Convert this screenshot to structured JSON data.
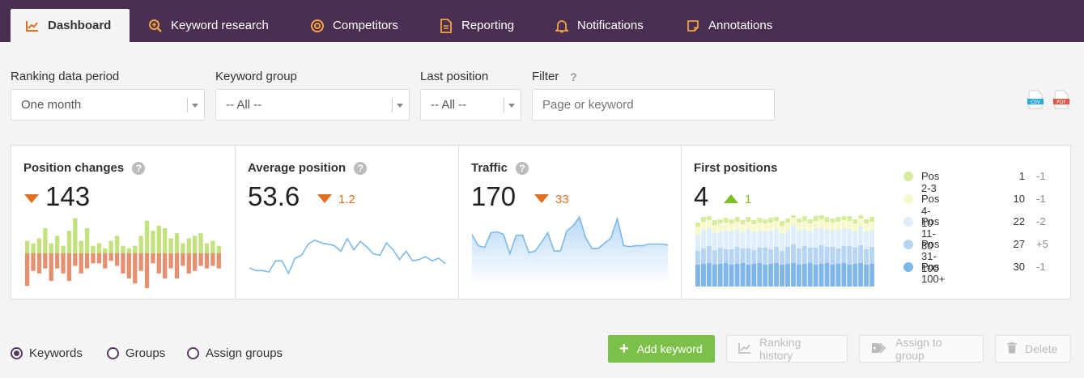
{
  "nav": {
    "tabs": [
      {
        "label": "Dashboard",
        "icon": "chart-line-icon"
      },
      {
        "label": "Keyword research",
        "icon": "magnifier-plus-icon"
      },
      {
        "label": "Competitors",
        "icon": "target-icon"
      },
      {
        "label": "Reporting",
        "icon": "document-icon"
      },
      {
        "label": "Notifications",
        "icon": "bell-icon"
      },
      {
        "label": "Annotations",
        "icon": "note-icon"
      }
    ],
    "active": "Dashboard"
  },
  "filters": {
    "period_label": "Ranking data period",
    "period_value": "One month",
    "group_label": "Keyword group",
    "group_value": "-- All --",
    "position_label": "Last position",
    "position_value": "-- All --",
    "filter_label": "Filter",
    "filter_help": "?",
    "filter_placeholder": "Page or keyword"
  },
  "export": {
    "csv_label": "CSV",
    "pdf_label": "PDF"
  },
  "stats": {
    "position_changes": {
      "title": "Position changes",
      "help": "?",
      "value": "143",
      "up": [
        5,
        4,
        6,
        10,
        4,
        7,
        3,
        9,
        14,
        5,
        10,
        3,
        4,
        2,
        5,
        7,
        3,
        2,
        3,
        7,
        13,
        9,
        11,
        10,
        6,
        8,
        4,
        6,
        7,
        8,
        4,
        5,
        3
      ],
      "down": [
        -13,
        -7,
        -8,
        -6,
        -11,
        -6,
        -8,
        -11,
        -5,
        -8,
        -6,
        -4,
        -4,
        -6,
        -3,
        -5,
        -8,
        -10,
        -12,
        -7,
        -14,
        -4,
        -8,
        -10,
        -6,
        -10,
        -5,
        -8,
        -7,
        -5,
        -6,
        -5,
        -6
      ]
    },
    "average_position": {
      "title": "Average position",
      "help": "?",
      "value": "53.6",
      "delta": "1.2",
      "series": [
        54.5,
        54.7,
        54.7,
        54.8,
        54.0,
        54.0,
        54.9,
        53.8,
        53.6,
        52.8,
        52.5,
        52.7,
        52.8,
        52.9,
        53.3,
        52.4,
        53.2,
        52.6,
        53.0,
        53.5,
        53.6,
        52.7,
        53.2,
        53.9,
        53.3,
        54.0,
        53.9,
        53.7,
        54.0,
        53.8,
        54.2
      ]
    },
    "traffic": {
      "title": "Traffic",
      "help": "?",
      "value": "170",
      "delta": "33",
      "series": [
        178,
        165,
        163,
        180,
        181,
        178,
        156,
        177,
        177,
        157,
        159,
        169,
        180,
        159,
        159,
        182,
        188,
        198,
        174,
        162,
        162,
        168,
        174,
        196,
        165,
        164,
        165,
        165,
        167,
        167,
        167,
        166
      ]
    },
    "first_positions": {
      "title": "First positions",
      "value": "4",
      "delta": "1",
      "legend": [
        {
          "name": "Pos 2-3",
          "value": "1",
          "diff": "-1",
          "color": "#d6ec9c"
        },
        {
          "name": "Pos 4-10",
          "value": "10",
          "diff": "-1",
          "color": "#f7f9cc"
        },
        {
          "name": "Pos 11-30",
          "value": "22",
          "diff": "-2",
          "color": "#deeefb"
        },
        {
          "name": "Pos 31-100",
          "value": "27",
          "diff": "+5",
          "color": "#b6d5f3"
        },
        {
          "name": "Pos 100+",
          "value": "30",
          "diff": "-1",
          "color": "#7fb6ea"
        }
      ]
    }
  },
  "bottom": {
    "radios": [
      {
        "label": "Keywords",
        "checked": true
      },
      {
        "label": "Groups",
        "checked": false
      },
      {
        "label": "Assign groups",
        "checked": false
      }
    ],
    "add_keyword": "Add keyword",
    "ranking_history": "Ranking history",
    "assign_to_group": "Assign to group",
    "delete": "Delete"
  },
  "colors": {
    "nav_bg": "#4b2f52",
    "accent_orange": "#e07020",
    "accent_green": "#7cc023",
    "bar_up": "#c3e27d",
    "bar_down": "#e59070",
    "line": "#7eb8e6"
  }
}
